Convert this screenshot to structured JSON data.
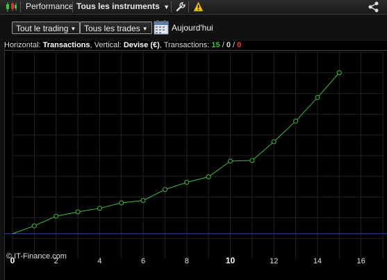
{
  "topbar": {
    "title": "Performance",
    "instrument_selector": "Tous les instruments",
    "icons": [
      "candlestick-icon",
      "wrench-icon",
      "warning-icon",
      "share-icon"
    ]
  },
  "toolbar": {
    "trading_filter": "Tout le trading",
    "trades_filter": "Tous les trades",
    "date_label": "Aujourd'hui"
  },
  "info": {
    "horizontal_prefix": "Horizontal:",
    "horizontal_value": "Transactions",
    "vertical_prefix": ", Vertical:",
    "vertical_value": "Devise (€)",
    "transactions_prefix": ", Transactions:",
    "count_total": "15",
    "sep1": " / ",
    "count_neutral": "0",
    "sep2": " / ",
    "count_losing": "0"
  },
  "watermark": "© IT-Finance.com",
  "colors": {
    "line": "#3fbf3f",
    "baseline": "#2a3fb0",
    "winning": "#33cc33",
    "losing": "#ff3333",
    "grid": "#222"
  },
  "chart_data": {
    "type": "line",
    "x": [
      0,
      1,
      2,
      3,
      4,
      5,
      6,
      7,
      8,
      9,
      10,
      11,
      12,
      13,
      14,
      15
    ],
    "y": [
      0,
      13,
      29,
      36,
      42,
      51,
      55,
      73,
      85,
      94,
      120,
      121,
      152,
      186,
      225,
      266
    ],
    "xlim": [
      0,
      17
    ],
    "ylim": [
      -42,
      300
    ],
    "x_ticks": [
      "0",
      "2",
      "4",
      "6",
      "8",
      "10",
      "12",
      "14",
      "16"
    ],
    "x_tick_values": [
      0,
      2,
      4,
      6,
      8,
      10,
      12,
      14,
      16
    ],
    "emphasized_x_ticks": [
      "0",
      "10"
    ],
    "grid": true,
    "baseline_y": 0
  }
}
